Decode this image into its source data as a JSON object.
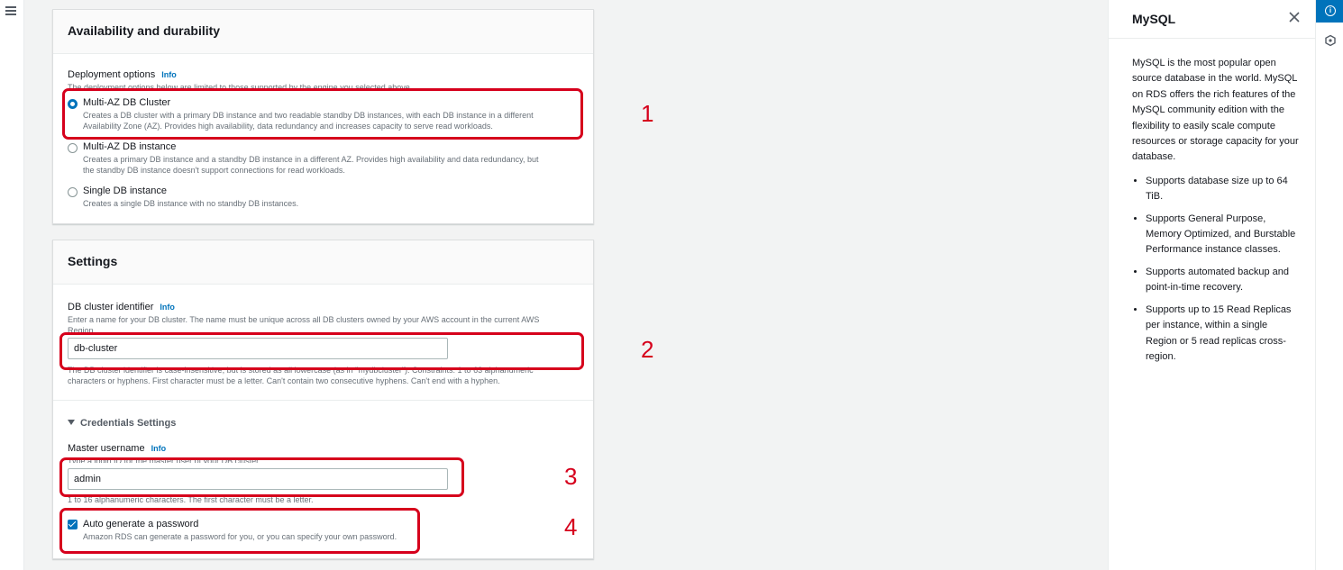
{
  "availability": {
    "title": "Availability and durability",
    "deployment_label": "Deployment options",
    "info": "Info",
    "deployment_desc": "The deployment options below are limited to those supported by the engine you selected above.",
    "options": [
      {
        "label": "Multi-AZ DB Cluster",
        "desc1": "Creates a DB cluster with a primary DB instance and two readable standby DB instances, with each DB instance in a different",
        "desc2": "Availability Zone (AZ). Provides high availability, data redundancy and increases capacity to serve read workloads."
      },
      {
        "label": "Multi-AZ DB instance",
        "desc1": "Creates a primary DB instance and a standby DB instance in a different AZ. Provides high availability and data redundancy, but",
        "desc2": "the standby DB instance doesn't support connections for read workloads."
      },
      {
        "label": "Single DB instance",
        "desc1": "Creates a single DB instance with no standby DB instances."
      }
    ]
  },
  "settings": {
    "title": "Settings",
    "cluster_id_label": "DB cluster identifier",
    "info": "Info",
    "cluster_id_desc1": "Enter a name for your DB cluster. The name must be unique across all DB clusters owned by your AWS account in the current AWS",
    "cluster_id_desc2": "Region.",
    "cluster_id_value": "db-cluster",
    "cluster_id_constraint1": "The DB cluster identifier is case-insensitive, but is stored as all lowercase (as in \"mydbcluster\"). Constraints: 1 to 63 alphanumeric",
    "cluster_id_constraint2": "characters or hyphens. First character must be a letter. Can't contain two consecutive hyphens. Can't end with a hyphen.",
    "credentials_toggle": "Credentials Settings",
    "username_label": "Master username",
    "username_desc": "Type a login ID for the master user of your DB cluster.",
    "username_value": "admin",
    "username_constraint": "1 to 16 alphanumeric characters. The first character must be a letter.",
    "autogen_label": "Auto generate a password",
    "autogen_desc": "Amazon RDS can generate a password for you, or you can specify your own password."
  },
  "annotations": [
    "1",
    "2",
    "3",
    "4"
  ],
  "help": {
    "title": "MySQL",
    "intro": "MySQL is the most popular open source database in the world. MySQL on RDS offers the rich features of the MySQL community edition with the flexibility to easily scale compute resources or storage capacity for your database.",
    "bullets": [
      "Supports database size up to 64 TiB.",
      "Supports General Purpose, Memory Optimized, and Burstable Performance instance classes.",
      "Supports automated backup and point-in-time recovery.",
      "Supports up to 15 Read Replicas per instance, within a single Region or 5 read replicas cross-region."
    ]
  },
  "icons": {
    "menu": "hamburger-icon",
    "close": "close-icon",
    "info": "info-icon",
    "tool": "hexagon-icon",
    "caret": "caret-down-icon",
    "check": "check-icon"
  },
  "colors": {
    "accent": "#0073bb",
    "annotation": "#d6001c"
  }
}
